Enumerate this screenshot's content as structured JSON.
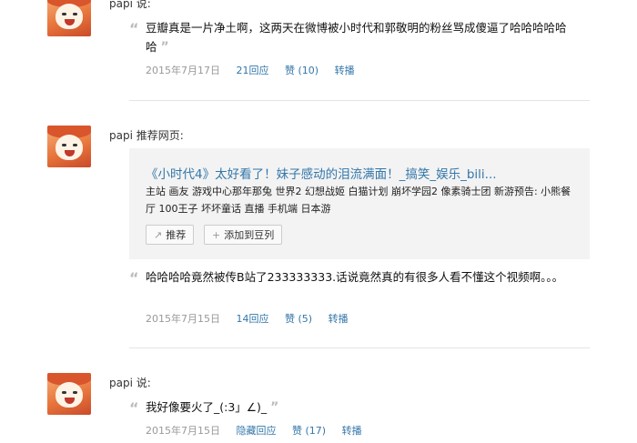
{
  "posts": [
    {
      "author": "papi 说:",
      "text": "豆瓣真是一片净土啊，这两天在微博被小时代和郭敬明的粉丝骂成傻逼了哈哈哈哈哈哈",
      "date": "2015年7月17日",
      "replies": "21回应",
      "likes": "赞 (10)",
      "share": "转播"
    },
    {
      "author": "papi 推荐网页:",
      "card": {
        "title": "《小时代4》太好看了！妹子感动的泪流满面！_搞笑_娱乐_bili...",
        "desc": "主站 画友 游戏中心那年那兔 世界2 幻想战姬 白猫计划 崩坏学园2 像素骑士团 新游预告: 小熊餐厅 100王子 坏坏童话 直播 手机端 日本游",
        "recommend_label": "推荐",
        "add_label": "添加到豆列"
      },
      "text": "哈哈哈哈竟然被传B站了233333333.话说竟然真的有很多人看不懂这个视频啊。。。",
      "date": "2015年7月15日",
      "replies": "14回应",
      "likes": "赞 (5)",
      "share": "转播"
    },
    {
      "author": "papi 说:",
      "text": "我好像要火了_(:3」∠)_",
      "date": "2015年7月15日",
      "replies": "隐藏回应",
      "likes": "赞 (17)",
      "share": "转播"
    }
  ],
  "icons": {
    "open_quote": "“",
    "close_quote": "”",
    "plus": "+",
    "share_arrow": "↗"
  }
}
